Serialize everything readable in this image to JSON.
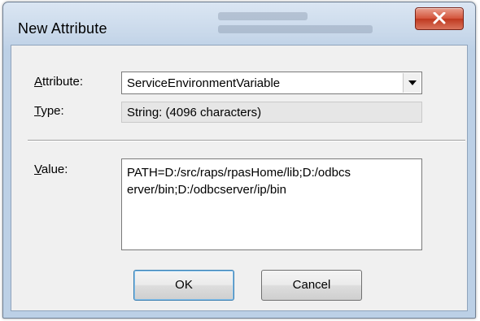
{
  "window": {
    "title": "New Attribute"
  },
  "form": {
    "attribute_label": "Attribute:",
    "attribute_label_access": "A",
    "attribute_label_rest": "ttribute:",
    "attribute_value": "ServiceEnvironmentVariable",
    "type_label_access": "T",
    "type_label_rest": "ype:",
    "type_value": "String: (4096 characters)",
    "value_label_access": "V",
    "value_label_rest": "alue:",
    "value_text": "PATH=D:/src/raps/rpasHome/lib;D:/odbcs\nerver/bin;D:/odbcserver/ip/bin"
  },
  "buttons": {
    "ok_label": "OK",
    "cancel_label": "Cancel"
  },
  "icons": {
    "close": "close-icon",
    "dropdown": "chevron-down-icon"
  },
  "colors": {
    "close_button": "#c9432a",
    "client_bg": "#f0f0f0",
    "frame": "#c8d8ea"
  }
}
